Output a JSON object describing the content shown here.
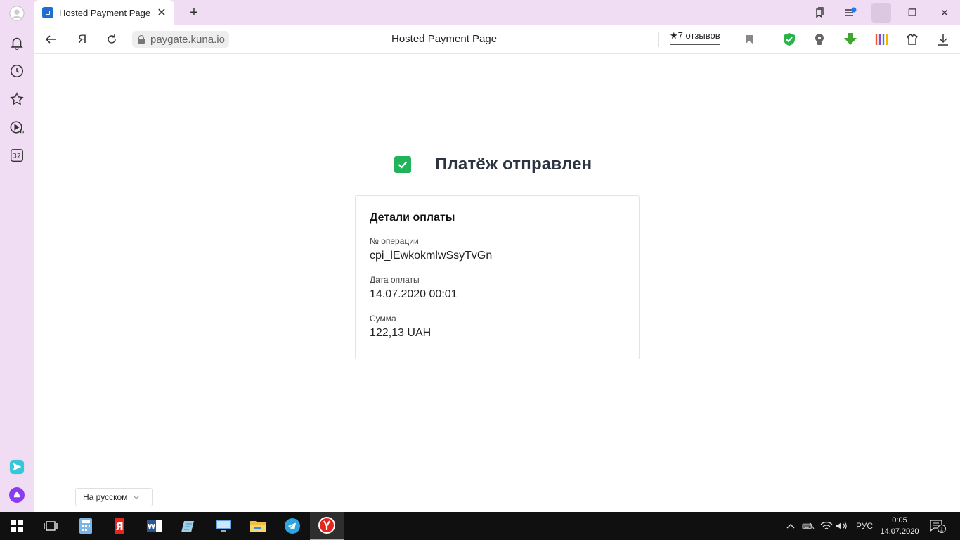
{
  "browser": {
    "tab": {
      "title": "Hosted Payment Page",
      "close": "✕"
    },
    "new_tab": "+",
    "window": {
      "minimize": "_",
      "restore": "❐",
      "close": "✕"
    },
    "address": {
      "yandex_glyph": "Я",
      "url": "paygate.kuna.io",
      "page_title": "Hosted Payment Page",
      "reviews": "★7 отзывов"
    },
    "sidebar_counter": "32"
  },
  "page": {
    "status_title": "Платёж отправлен",
    "card": {
      "title": "Детали оплаты",
      "fields": [
        {
          "label": "№ операции",
          "value": "cpi_lEwkokmlwSsyTvGn"
        },
        {
          "label": "Дата оплаты",
          "value": "14.07.2020 00:01"
        },
        {
          "label": "Сумма",
          "value": "122,13 UAH"
        }
      ]
    },
    "language_select": "На русском"
  },
  "taskbar": {
    "language": "РУС",
    "time": "0:05",
    "date": "14.07.2020",
    "notifications": "1"
  },
  "colors": {
    "sidebar_bg": "#f0dcf3",
    "success_green": "#21b35a",
    "taskbar_bg": "#101010"
  }
}
